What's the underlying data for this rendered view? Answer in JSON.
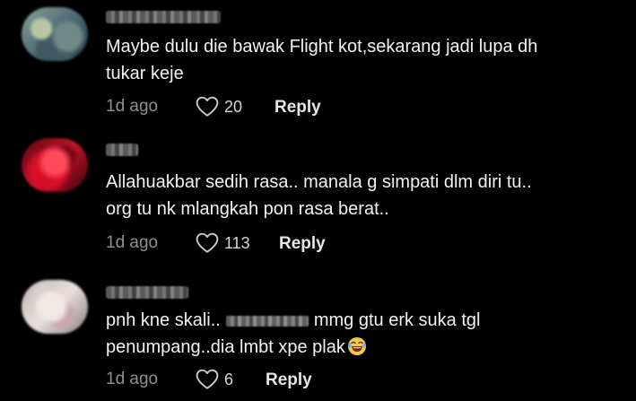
{
  "colors": {
    "background": "#000000",
    "text": "#f2f2f2",
    "meta": "#8f8f8f",
    "reply": "#e6e6e6"
  },
  "comments": [
    {
      "text_line1": "Maybe dulu die bawak Flight kot,sekarang jadi lupa dh",
      "text_line2": "tukar keje",
      "time": "1d ago",
      "likes": "20",
      "reply_label": "Reply",
      "avatar_icon": "blurred-avatar",
      "heart_icon": "heart-outline-icon"
    },
    {
      "text_line1": "Allahuakbar sedih rasa.. manala g simpati dlm diri tu..",
      "text_line2": "org tu nk mlangkah pon rasa berat..",
      "time": "1d ago",
      "likes": "113",
      "reply_label": "Reply",
      "avatar_icon": "blurred-avatar",
      "heart_icon": "heart-outline-icon"
    },
    {
      "text_line1_a": "pnh kne skali..",
      "text_line1_b": "mmg gtu erk suka tgl",
      "text_line2": "penumpang..dia lmbt xpe plak",
      "time": "1d ago",
      "likes": "6",
      "reply_label": "Reply",
      "avatar_icon": "blurred-avatar",
      "heart_icon": "heart-outline-icon",
      "emoji_icon": "laughing-tears-emoji-icon"
    }
  ]
}
